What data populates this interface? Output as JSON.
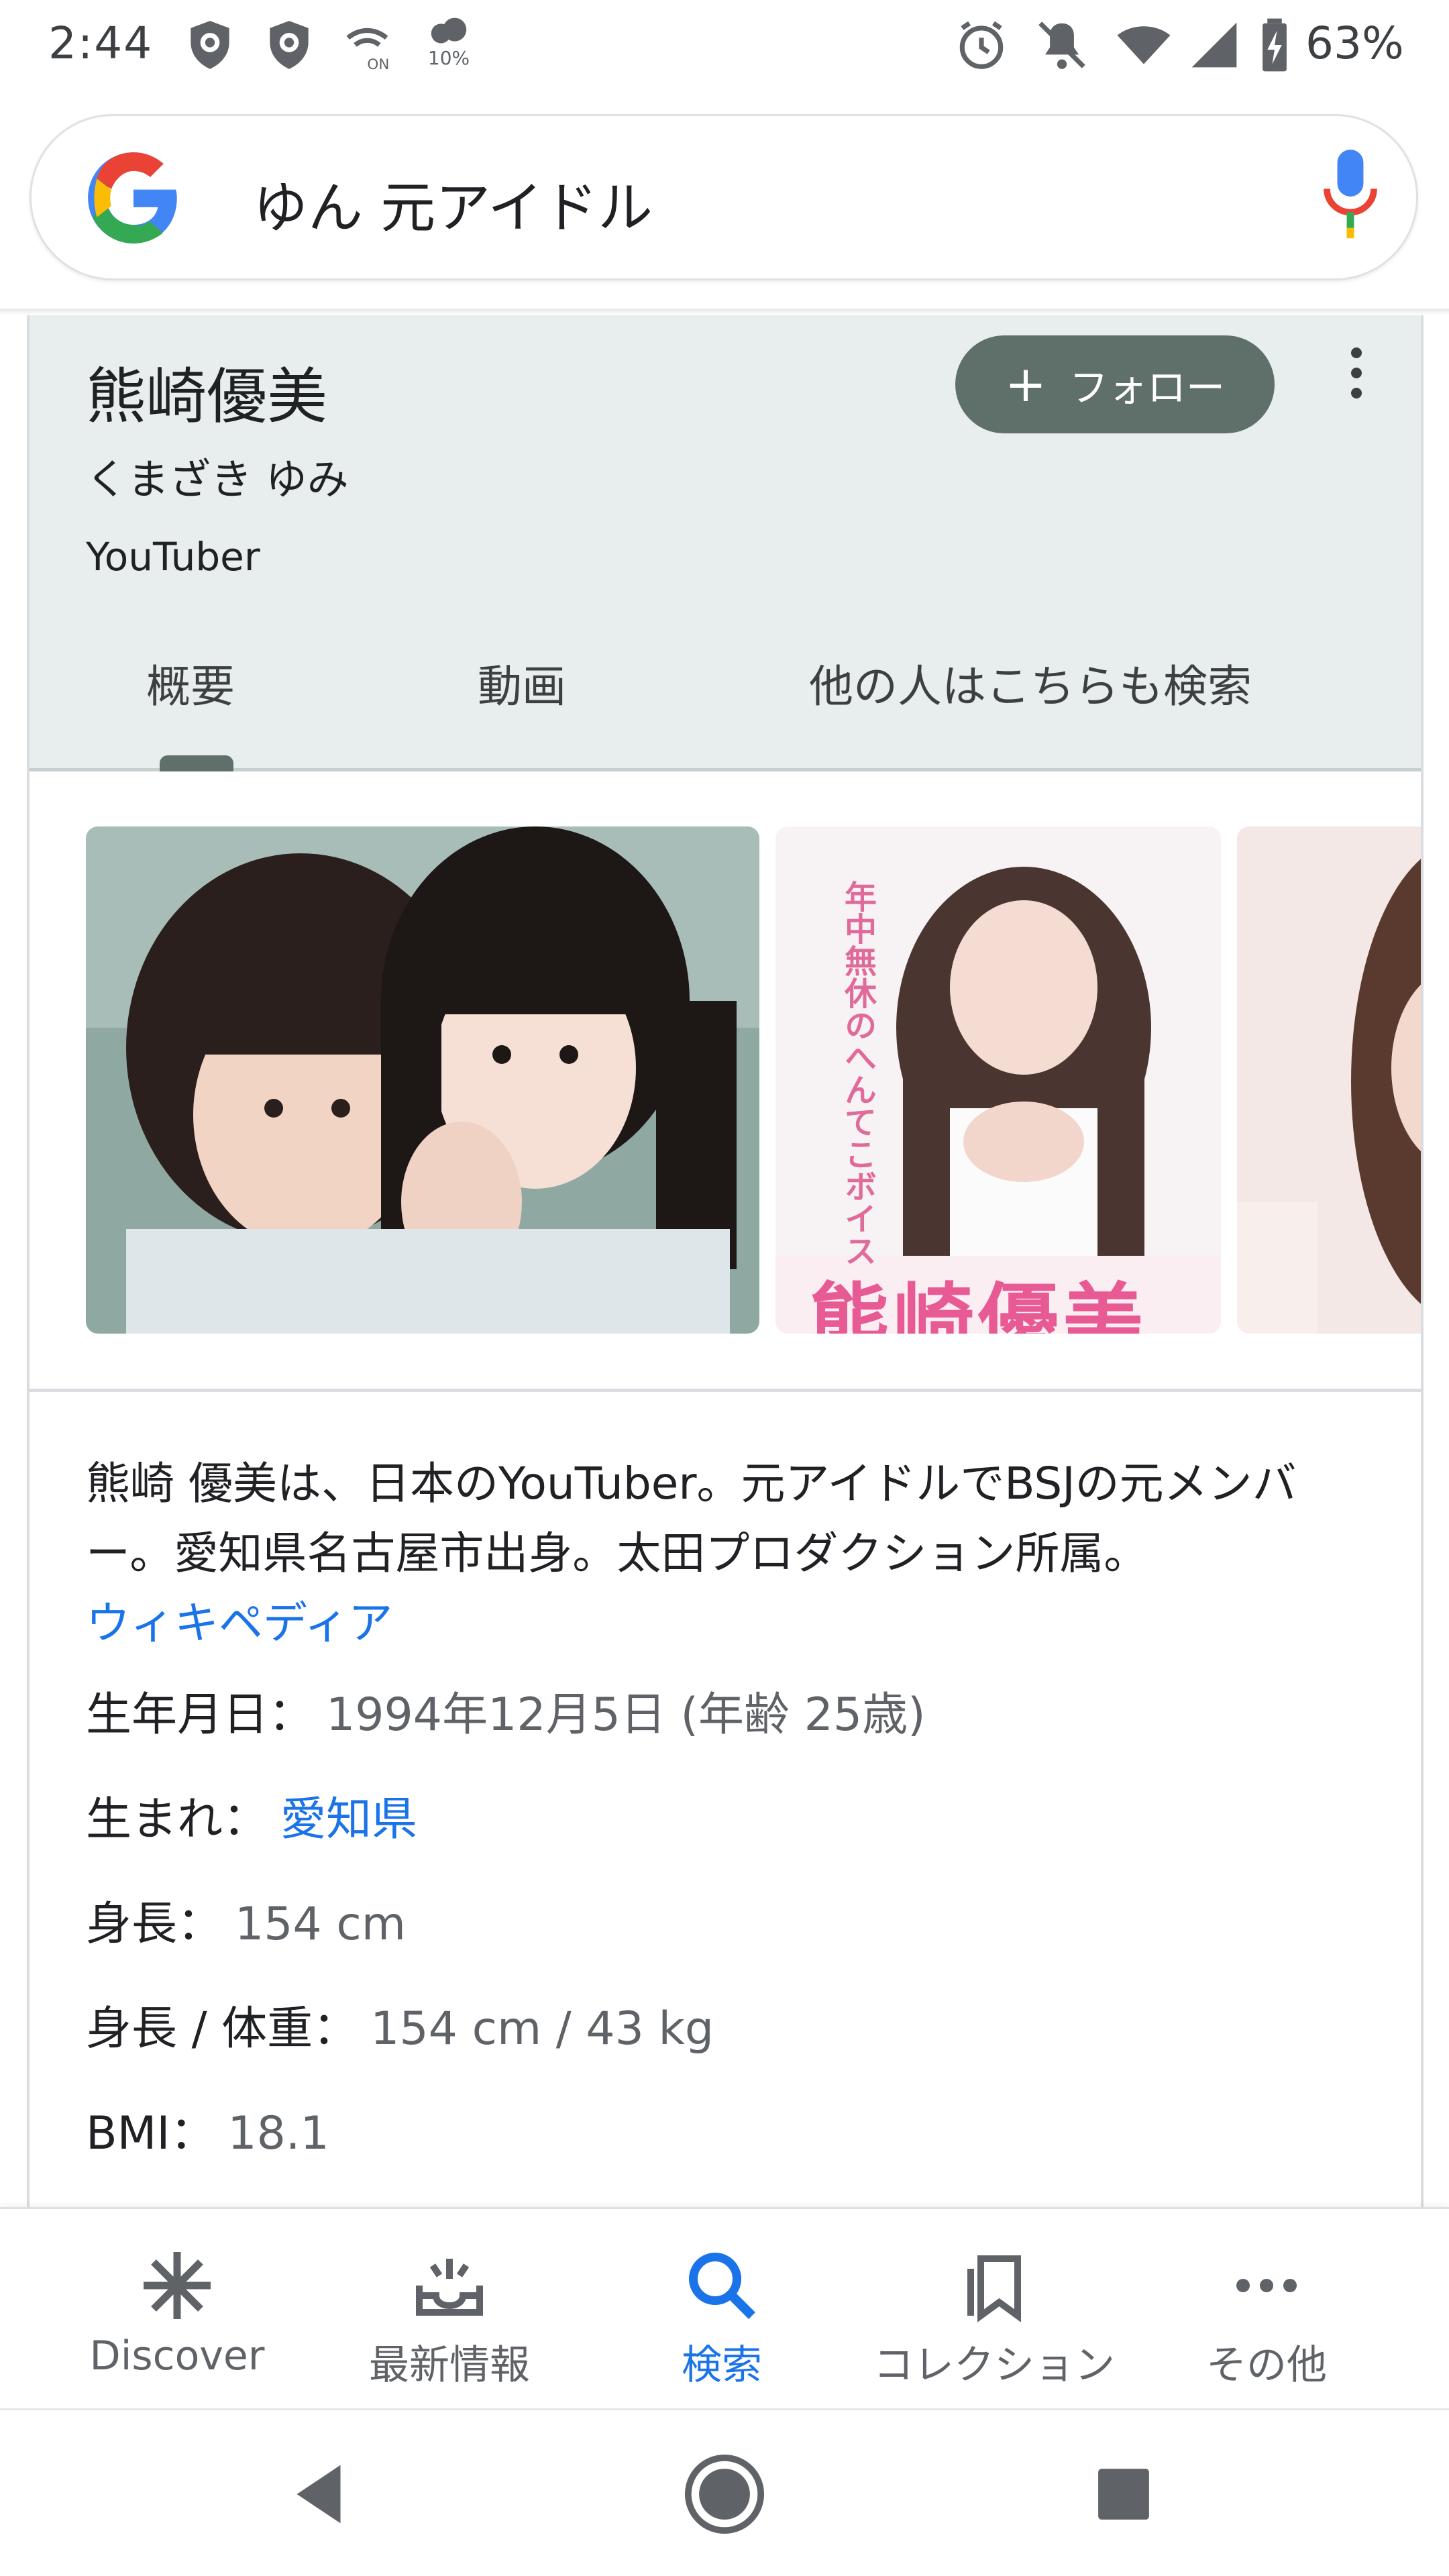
{
  "status_bar": {
    "time": "2:44",
    "data_saver_percent": "10%",
    "battery_percent": "63%"
  },
  "search": {
    "query": "ゆん 元アイドル"
  },
  "knowledge_panel": {
    "title": "熊崎優美",
    "reading": "くまざき ゆみ",
    "type": "YouTuber",
    "follow_label": "フォロー",
    "tabs": [
      {
        "label": "概要",
        "active": true
      },
      {
        "label": "動画",
        "active": false
      },
      {
        "label": "他の人はこちらも検索",
        "active": false
      }
    ],
    "images": [
      {
        "icon": "photo-two-girls"
      },
      {
        "icon": "photo-poster",
        "vertical_text": "年中無休のへんてこボイス",
        "poster_name": "熊崎優美"
      },
      {
        "icon": "photo-partial"
      }
    ],
    "description": "熊崎 優美は、日本のYouTuber。元アイドルでBSJの元メンバー。愛知県名古屋市出身。太田プロダクション所属。",
    "wiki_link": "ウィキペディア",
    "facts": [
      {
        "label": "生年月日：",
        "value": "1994年12月5日 (年齢 25歳)",
        "link": false
      },
      {
        "label": "生まれ：",
        "value": "愛知県",
        "link": true
      },
      {
        "label": "身長：",
        "value": "154 cm",
        "link": false
      },
      {
        "label": "身長 / 体重：",
        "value": "154 cm / 43 kg",
        "link": false
      },
      {
        "label": "BMI：",
        "value": "18.1",
        "link": false
      }
    ]
  },
  "bottom_nav": {
    "items": [
      {
        "label": "Discover",
        "icon": "asterisk-icon"
      },
      {
        "label": "最新情報",
        "icon": "updates-tray-icon"
      },
      {
        "label": "検索",
        "icon": "search-icon",
        "active": true
      },
      {
        "label": "コレクション",
        "icon": "collections-icon"
      },
      {
        "label": "その他",
        "icon": "more-horiz-icon"
      }
    ]
  },
  "colors": {
    "accent_blue": "#1a73e8",
    "follow_button": "#5f6f6a",
    "panel_header": "#e8eeee"
  }
}
